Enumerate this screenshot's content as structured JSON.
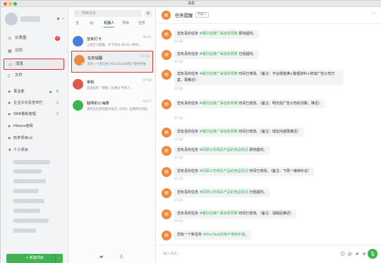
{
  "window": {
    "title": "消息"
  },
  "sidebar": {
    "nav": [
      {
        "label": "仪表盘",
        "badge": "2",
        "icon": "dashboard-icon"
      },
      {
        "label": "日历",
        "badge": "",
        "icon": "calendar-icon"
      },
      {
        "label": "消息",
        "badge": "",
        "icon": "message-icon",
        "active": true
      },
      {
        "label": "文件",
        "badge": "",
        "icon": "file-icon"
      }
    ],
    "groups": [
      {
        "label": "事业部",
        "count": "8"
      },
      {
        "label": "企业文化及宣传栏",
        "count": "2"
      },
      {
        "label": "OKR看板管理",
        "count": "2"
      },
      {
        "label": "Hiboss官网",
        "count": ""
      },
      {
        "label": "奶茶项目v2",
        "count": ""
      },
      {
        "label": "个人项目",
        "count": ""
      }
    ],
    "new_button": "+ 新建项目"
  },
  "list": {
    "search_placeholder": "搜索消息",
    "add": "+",
    "tabs": [
      "全",
      "@",
      "机器人",
      "项目",
      "任务"
    ],
    "items": [
      {
        "title": "签到打卡",
        "message": "上班打卡提醒，打卡时间 09:01 (手机)...",
        "date": "09:01",
        "color": "#4a7cdf",
        "glyph": "✓"
      },
      {
        "title": "任务提醒",
        "message": "您有一个新任务 #DocTask的用户使用手册",
        "date": "07-02",
        "color": "#f0883e",
        "glyph": "▤",
        "selected": true
      },
      {
        "title": "审批",
        "message": "您发起的「请假」已通过 申请人：",
        "date": "07-08",
        "color": "#e05a4a",
        "glyph": "✎",
        "badge": "1"
      },
      {
        "title": "聪明的小海豚",
        "message": "请常见任务的提问技巧（问问）主要用于团队",
        "date": "04-27",
        "color": "#3eb34f",
        "glyph": "◉"
      }
    ]
  },
  "chat": {
    "title": "任务提醒",
    "badge": "机器人",
    "input_placeholder": "输入消息...",
    "messages": [
      {
        "pre": "您负责的任务 ",
        "link": "#餐饮店推广渠道和预算",
        "post": " 即将超时。",
        "time": "07-02"
      },
      {
        "pre": "您负责的任务 ",
        "link": "#餐饮店推广渠道和预算",
        "post": " 已经超时。",
        "time": "07-02"
      },
      {
        "pre": "您负责的任务 ",
        "link": "#餐饮店推广渠道和预算",
        "post": " 时间已修改。（备注：平台搭建满+整理资料+增加广告公司方案，再推迟）",
        "time": "07-02"
      },
      {
        "pre": "您负责的任务 ",
        "link": "#餐饮店推广渠道和预算",
        "post": " 时间已修改。（备注：明天找广告公司的详聊，推迟）",
        "time": "07-02"
      },
      {
        "pre": "您负责的任务 ",
        "link": "#餐饮店推广渠道和预算",
        "post": " 时间已修改。（备注：增加沟通再推迟）",
        "time": "07-02"
      },
      {
        "pre": "您负责的任务 ",
        "link": "#调研公司相关产品的竞品情况",
        "post": " 即将超时。",
        "time": "07-02"
      },
      {
        "pre": "您负责的任务 ",
        "link": "#调研公司相关产品的竞品情况",
        "post": " 时间已修改。（备注：下周一继续补充）",
        "time": "07-02"
      },
      {
        "pre": "您负责的任务 ",
        "link": "#调研公司相关产品的竞品情况",
        "post": " 已经超时。",
        "time": "07-02"
      },
      {
        "pre": "您负责的任务 ",
        "link": "#餐饮店推广渠道和预算",
        "post": " 时间已修改。（备注：请假后推迟）",
        "time": "07-02"
      },
      {
        "pre": "您有一个新任务 ",
        "link": "#DocTask的用户使用手册",
        "post": "。",
        "time": ""
      }
    ]
  }
}
